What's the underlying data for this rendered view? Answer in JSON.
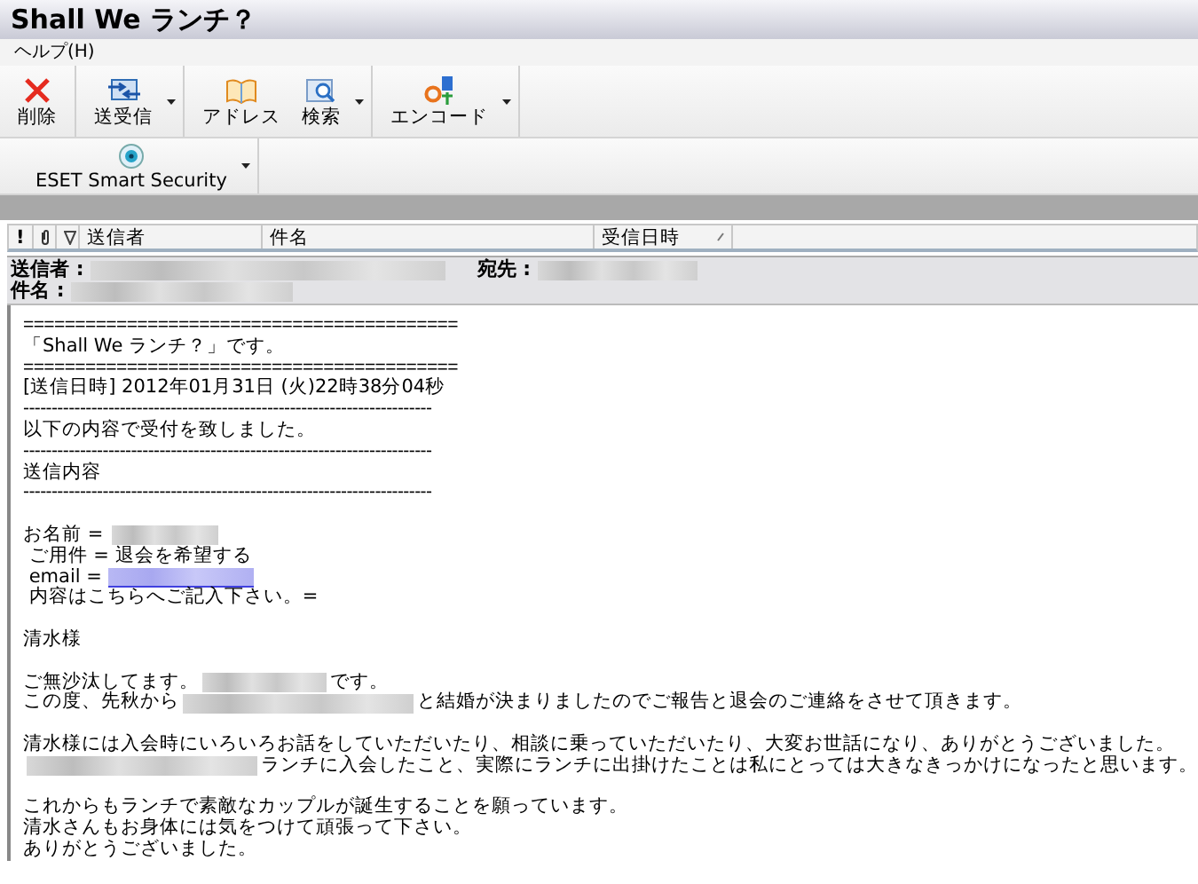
{
  "window": {
    "title": "Shall We ランチ？"
  },
  "menu": [
    "ヘルプ(H)"
  ],
  "toolbar": [
    {
      "kind": "delete",
      "label": "削除",
      "dropdown": false
    },
    {
      "kind": "sendreceive",
      "label": "送受信",
      "dropdown": true
    },
    {
      "kind": "address",
      "label": "アドレス",
      "dropdown": false
    },
    {
      "kind": "search",
      "label": "検索",
      "dropdown": true
    },
    {
      "kind": "encode",
      "label": "エンコード",
      "dropdown": true
    }
  ],
  "toolbar2": [
    {
      "kind": "eset",
      "label": "ESET Smart Security",
      "dropdown": true
    }
  ],
  "columns": [
    {
      "kind": "priority",
      "label": "!"
    },
    {
      "kind": "attachment"
    },
    {
      "kind": "flag"
    },
    {
      "kind": "text",
      "label": "送信者"
    },
    {
      "kind": "text",
      "label": "件名"
    },
    {
      "kind": "sorted",
      "label": "受信日時"
    }
  ],
  "header": {
    "from_label": "送信者 :",
    "to_label": "宛先 :",
    "subject_label": "件名 :"
  },
  "body": [
    {
      "kind": "text",
      "parts": [
        {
          "kind": "text",
          "text": "=========================================="
        }
      ]
    },
    {
      "kind": "text",
      "parts": [
        {
          "kind": "text",
          "text": "「Shall We ランチ？」です。"
        }
      ]
    },
    {
      "kind": "text",
      "parts": [
        {
          "kind": "text",
          "text": "=========================================="
        }
      ]
    },
    {
      "kind": "text",
      "parts": [
        {
          "kind": "text",
          "text": "[送信日時] 2012年01月31日 (火)22時38分04秒"
        }
      ]
    },
    {
      "kind": "text",
      "parts": [
        {
          "kind": "text",
          "text": "------------------------------------------------------------------------"
        }
      ]
    },
    {
      "kind": "text",
      "parts": [
        {
          "kind": "text",
          "text": "以下の内容で受付を致しました。"
        }
      ]
    },
    {
      "kind": "text",
      "parts": [
        {
          "kind": "text",
          "text": "------------------------------------------------------------------------"
        }
      ]
    },
    {
      "kind": "text",
      "parts": [
        {
          "kind": "text",
          "text": "送信内容"
        }
      ]
    },
    {
      "kind": "text",
      "parts": [
        {
          "kind": "text",
          "text": "------------------------------------------------------------------------"
        }
      ]
    },
    {
      "kind": "blank"
    },
    {
      "kind": "text",
      "parts": [
        {
          "kind": "text",
          "text": "お名前 = "
        },
        {
          "kind": "redacted"
        }
      ]
    },
    {
      "kind": "text",
      "parts": [
        {
          "kind": "text",
          "text": " ご用件 = 退会を希望する"
        }
      ]
    },
    {
      "kind": "text",
      "parts": [
        {
          "kind": "text",
          "text": " email = "
        },
        {
          "kind": "redacted-link"
        }
      ]
    },
    {
      "kind": "text",
      "parts": [
        {
          "kind": "text",
          "text": " 内容はこちらへご記入下さい。="
        }
      ]
    },
    {
      "kind": "blank"
    },
    {
      "kind": "text",
      "parts": [
        {
          "kind": "text",
          "text": "清水様"
        }
      ]
    },
    {
      "kind": "blank"
    },
    {
      "kind": "text",
      "parts": [
        {
          "kind": "text",
          "text": "ご無沙汰してます。"
        },
        {
          "kind": "redacted"
        },
        {
          "kind": "text",
          "text": "です。"
        }
      ]
    },
    {
      "kind": "text",
      "parts": [
        {
          "kind": "text",
          "text": "この度、先秋から"
        },
        {
          "kind": "redacted"
        },
        {
          "kind": "text",
          "text": "と結婚が決まりましたのでご報告と退会のご連絡をさせて頂きます。"
        }
      ]
    },
    {
      "kind": "blank"
    },
    {
      "kind": "text",
      "parts": [
        {
          "kind": "text",
          "text": "清水様には入会時にいろいろお話をしていただいたり、相談に乗っていただいたり、大変お世話になり、ありがとうございました。"
        }
      ]
    },
    {
      "kind": "text",
      "parts": [
        {
          "kind": "redacted"
        },
        {
          "kind": "text",
          "text": "ランチに入会したこと、実際にランチに出掛けたことは私にとっては大きなきっかけになったと思います。"
        }
      ]
    },
    {
      "kind": "blank"
    },
    {
      "kind": "text",
      "parts": [
        {
          "kind": "text",
          "text": "これからもランチで素敵なカップルが誕生することを願っています。"
        }
      ]
    },
    {
      "kind": "text",
      "parts": [
        {
          "kind": "text",
          "text": "清水さんもお身体には気をつけて頑張って下さい。"
        }
      ]
    },
    {
      "kind": "text",
      "parts": [
        {
          "kind": "text",
          "text": "ありがとうございました。"
        }
      ]
    }
  ]
}
